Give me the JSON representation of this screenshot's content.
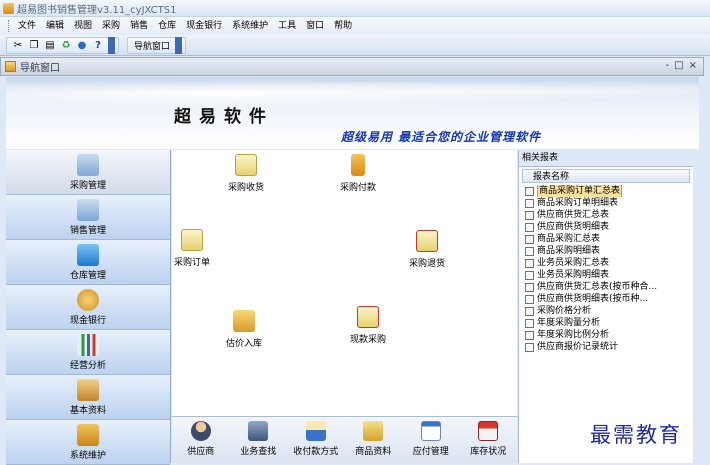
{
  "window": {
    "title": "超易图书销售管理v3.11_cyJXCTS1"
  },
  "menu": [
    "文件",
    "编辑",
    "视图",
    "采购",
    "销售",
    "仓库",
    "现金银行",
    "系统维护",
    "工具",
    "窗口",
    "帮助"
  ],
  "toolbar": {
    "nav_window_label": "导航窗口"
  },
  "nav_window": {
    "title": "导航窗口",
    "controls": [
      "-",
      "□",
      "×"
    ]
  },
  "banner": {
    "title": "超易软件",
    "slogan": "超级易用  最适合您的企业管理软件"
  },
  "left_nav": [
    {
      "label": "采购管理",
      "icon": "cart-icon",
      "color": "#8fb3d9"
    },
    {
      "label": "销售管理",
      "icon": "cart-icon",
      "color": "#8fb3d9"
    },
    {
      "label": "仓库管理",
      "icon": "warehouse-icon",
      "color": "#2c8fe0"
    },
    {
      "label": "现金银行",
      "icon": "money-bag-icon",
      "color": "#e0a72c"
    },
    {
      "label": "经营分析",
      "icon": "bar-chart-icon",
      "color": "#3aa845"
    },
    {
      "label": "基本资料",
      "icon": "book-icon",
      "color": "#c98a2a"
    },
    {
      "label": "系统维护",
      "icon": "hammer-icon",
      "color": "#d89a25"
    }
  ],
  "functions": {
    "purchase_receive": "采购收货",
    "purchase_pay": "采购付款",
    "purchase_order": "采购订单",
    "purchase_return": "采购退货",
    "price_inbound": "估价入库",
    "cash_purchase": "现款采购"
  },
  "bottom_bar": [
    "供应商",
    "业务查找",
    "收付款方式",
    "商品资料",
    "应付管理",
    "库存状况"
  ],
  "related_reports": {
    "title": "相关报表",
    "column": "报表名称",
    "items": [
      "商品采购订单汇总表",
      "商品采购订单明细表",
      "供应商供货汇总表",
      "供应商供货明细表",
      "商品采购汇总表",
      "商品采购明细表",
      "业务员采购汇总表",
      "业务员采购明细表",
      "供应商供货汇总表(按币种合...",
      "供应商供货明细表(按币种...",
      "采购价格分析",
      "年度采购量分析",
      "年度采购比例分析",
      "供应商报价记录统计"
    ],
    "selected_index": 0
  },
  "watermark": "最需教育",
  "colors": {
    "accent": "#1436b8",
    "selection": "#fbe19b"
  }
}
